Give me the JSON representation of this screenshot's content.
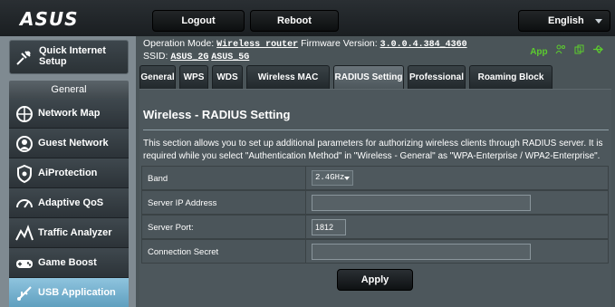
{
  "brand": {
    "logo": "ASUS"
  },
  "topbar": {
    "logout": "Logout",
    "reboot": "Reboot",
    "language": "English"
  },
  "sidebar": {
    "quick_setup": "Quick Internet Setup",
    "section": "General",
    "items": [
      {
        "label": "Network Map",
        "icon": "network-map-icon"
      },
      {
        "label": "Guest Network",
        "icon": "guest-network-icon"
      },
      {
        "label": "AiProtection",
        "icon": "aiprotection-icon"
      },
      {
        "label": "Adaptive QoS",
        "icon": "adaptive-qos-icon"
      },
      {
        "label": "Traffic Analyzer",
        "icon": "traffic-analyzer-icon"
      },
      {
        "label": "Game Boost",
        "icon": "game-boost-icon"
      },
      {
        "label": "USB Application",
        "icon": "usb-application-icon",
        "active": true
      }
    ]
  },
  "info": {
    "op_mode_label": "Operation Mode:",
    "op_mode_value": "Wireless router",
    "fw_label": "Firmware Version:",
    "fw_value": "3.0.0.4.384_4360",
    "ssid_label": "SSID:",
    "ssid_2g": "ASUS_2G",
    "ssid_5g": "ASUS_5G",
    "app_label": "App"
  },
  "tabs": [
    "General",
    "WPS",
    "WDS",
    "Wireless MAC Filter",
    "RADIUS Setting",
    "Professional",
    "Roaming Block List"
  ],
  "active_tab": "RADIUS Setting",
  "panel": {
    "title": "Wireless - RADIUS Setting",
    "description": "This section allows you to set up additional parameters for authorizing wireless clients through RADIUS server. It is required while you select \"Authentication Method\" in \"Wireless - General\" as \"WPA-Enterprise / WPA2-Enterprise\".",
    "fields": {
      "band_label": "Band",
      "band_value": "2.4GHz",
      "server_ip_label": "Server IP Address",
      "server_ip_value": "",
      "server_port_label": "Server Port:",
      "server_port_value": "1812",
      "secret_label": "Connection Secret",
      "secret_value": ""
    },
    "apply": "Apply"
  },
  "colors": {
    "accent_active": "#8fc4de",
    "status_green": "#5ccc2e",
    "panel_bg": "#4d575c"
  }
}
